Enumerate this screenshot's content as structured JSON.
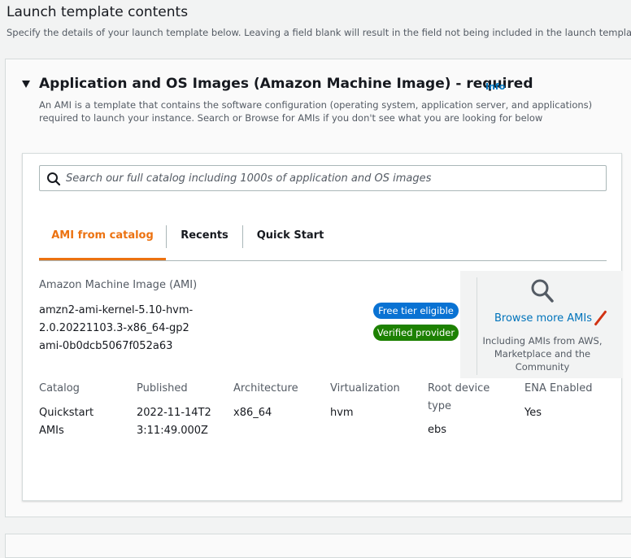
{
  "page": {
    "title": "Launch template contents",
    "description": "Specify the details of your launch template below. Leaving a field blank will result in the field not being included in the launch template."
  },
  "section": {
    "title": "Application and OS Images (Amazon Machine Image) - required",
    "info_label": "Info",
    "description": "An AMI is a template that contains the software configuration (operating system, application server, and applications) required to launch your instance. Search or Browse for AMIs if you don't see what you are looking for below"
  },
  "search": {
    "placeholder": "Search our full catalog including 1000s of application and OS images",
    "icon": "search-icon"
  },
  "tabs": [
    {
      "label": "AMI from catalog",
      "active": true
    },
    {
      "label": "Recents",
      "active": false
    },
    {
      "label": "Quick Start",
      "active": false
    }
  ],
  "ami": {
    "label": "Amazon Machine Image (AMI)",
    "name_line1": "amzn2-ami-kernel-5.10-hvm-",
    "name_line2": "2.0.20221103.3-x86_64-gp2",
    "id": "ami-0b0dcb5067f052a63",
    "badges": [
      {
        "label": "Free tier eligible",
        "color": "#0972d3"
      },
      {
        "label": "Verified provider",
        "color": "#1d8102"
      }
    ]
  },
  "browse": {
    "icon": "magnifier-icon",
    "link": "Browse more AMIs",
    "description": "Including AMIs from AWS, Marketplace and the Community"
  },
  "details": [
    {
      "header": "Catalog",
      "value": "Quickstart AMIs"
    },
    {
      "header": "Published",
      "value": "2022-11-14T23:11:49.000Z"
    },
    {
      "header": "Architecture",
      "value": "x86_64"
    },
    {
      "header": "Virtualization",
      "value": "hvm"
    },
    {
      "header": "Root device type",
      "value": "ebs"
    },
    {
      "header": "ENA Enabled",
      "value": "Yes"
    }
  ],
  "colors": {
    "accent_orange": "#ec7211",
    "link_blue": "#0073bb",
    "badge_blue": "#0972d3",
    "badge_green": "#1d8102"
  }
}
